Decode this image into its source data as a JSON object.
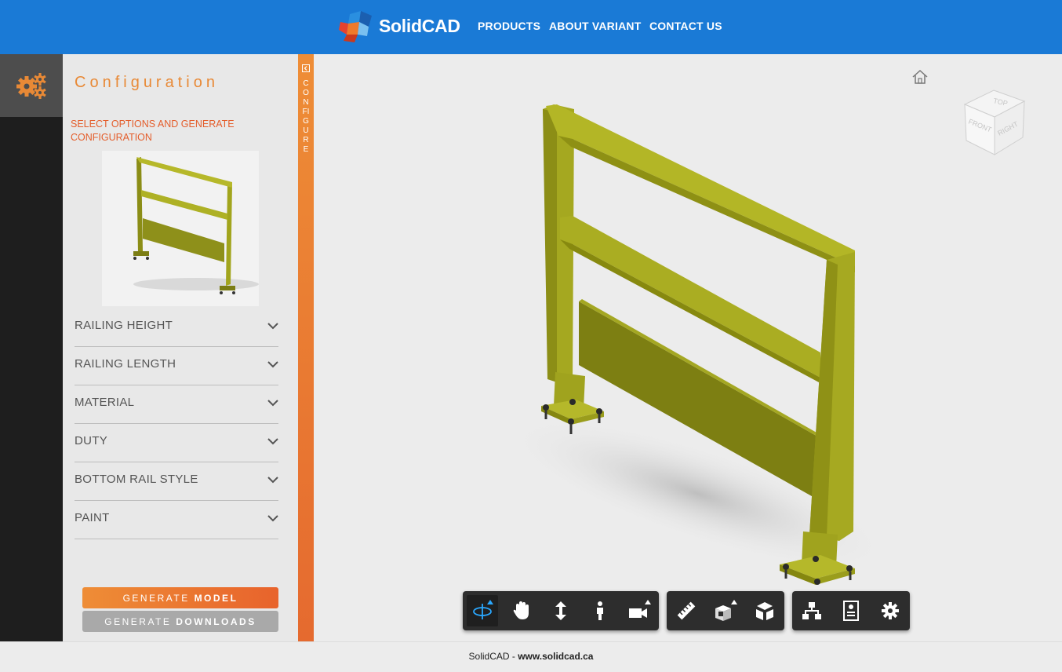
{
  "header": {
    "brand": "SolidCAD",
    "nav": [
      "PRODUCTS",
      "ABOUT VARIANT",
      "CONTACT US"
    ]
  },
  "panel": {
    "title": "Configuration",
    "subtitle": "SELECT OPTIONS AND GENERATE CONFIGURATION",
    "options": [
      "RAILING HEIGHT",
      "RAILING LENGTH",
      "MATERIAL",
      "DUTY",
      "BOTTOM RAIL STYLE",
      "PAINT"
    ],
    "generate_model": {
      "prefix": "GENERATE",
      "bold": "MODEL"
    },
    "generate_downloads": {
      "prefix": "GENERATE",
      "bold": "DOWNLOADS"
    }
  },
  "side_tab": {
    "label": "CONFIGURE"
  },
  "viewcube": {
    "top": "TOP",
    "front": "FRONT",
    "right": "RIGHT"
  },
  "toolbar": {
    "group1": [
      "orbit-icon",
      "pan-icon",
      "zoom-icon",
      "first-person-icon",
      "camera-icon"
    ],
    "group2": [
      "measure-icon",
      "section-icon",
      "explode-icon"
    ],
    "group3": [
      "model-browser-icon",
      "properties-icon",
      "settings-icon"
    ]
  },
  "footer": {
    "name": "SolidCAD",
    "separator": " - ",
    "url": "www.solidcad.ca"
  },
  "colors": {
    "header": "#1a7ad6",
    "accent": "#e88936",
    "rail": "#a6a81e",
    "toolbar": "#2d2d2d"
  }
}
